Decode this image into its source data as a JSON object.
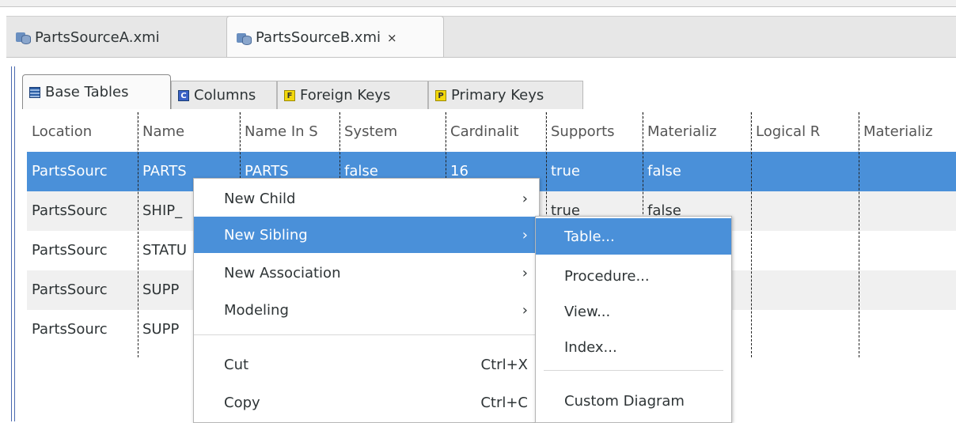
{
  "editor_tabs": [
    {
      "label": "PartsSourceA.xmi",
      "icon": "xmi-model-icon"
    },
    {
      "label": "PartsSourceB.xmi",
      "icon": "xmi-model-icon",
      "close": "⨯"
    }
  ],
  "inner_tabs": [
    {
      "label": "Base Tables",
      "icon": "table-icon"
    },
    {
      "label": "Columns",
      "icon": "column-icon",
      "glyph": "C"
    },
    {
      "label": "Foreign Keys",
      "icon": "foreign-key-icon",
      "glyph": "F"
    },
    {
      "label": "Primary Keys",
      "icon": "primary-key-icon",
      "glyph": "P"
    }
  ],
  "table": {
    "columns": [
      "Location",
      "Name",
      "Name In S",
      "System",
      "Cardinalit",
      "Supports",
      "Materializ",
      "Logical R",
      "Materializ"
    ],
    "rows": [
      [
        "PartsSourc",
        "PARTS",
        "PARTS",
        "false",
        "16",
        "true",
        "false",
        "",
        ""
      ],
      [
        "PartsSourc",
        "SHIP_",
        "",
        "",
        "",
        "true",
        "false",
        "",
        ""
      ],
      [
        "PartsSourc",
        "STATU",
        "",
        "",
        "",
        "",
        "",
        "",
        ""
      ],
      [
        "PartsSourc",
        "SUPP",
        "",
        "",
        "",
        "",
        "",
        "",
        ""
      ],
      [
        "PartsSourc",
        "SUPP",
        "",
        "",
        "",
        "",
        "",
        "",
        ""
      ]
    ]
  },
  "context_menu": {
    "items": [
      {
        "label": "New Child",
        "arrow": "›"
      },
      {
        "label": "New Sibling",
        "arrow": "›"
      },
      {
        "label": "New Association",
        "arrow": "›"
      },
      {
        "label": "Modeling",
        "arrow": "›"
      },
      {
        "label": "Cut",
        "accel": "Ctrl+X"
      },
      {
        "label": "Copy",
        "accel": "Ctrl+C"
      }
    ]
  },
  "submenu": {
    "items": [
      "Table...",
      "Procedure...",
      "View...",
      "Index...",
      "Custom Diagram"
    ]
  },
  "colors": {
    "selection": "#4a90d9",
    "row_alt": "#f0f0f0"
  }
}
